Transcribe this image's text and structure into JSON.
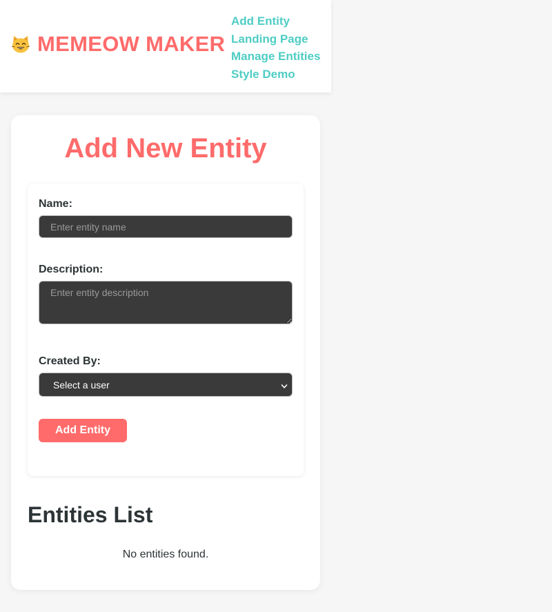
{
  "header": {
    "brand_icon": "smiling-cat-face-icon",
    "brand_title": "MEMEOW MAKER",
    "nav": [
      {
        "label": "Add Entity"
      },
      {
        "label": "Landing Page"
      },
      {
        "label": "Manage Entities"
      },
      {
        "label": "Style Demo"
      }
    ]
  },
  "form": {
    "title": "Add New Entity",
    "name_label": "Name:",
    "name_value": "",
    "name_placeholder": "Enter entity name",
    "description_label": "Description:",
    "description_value": "",
    "description_placeholder": "Enter entity description",
    "created_by_label": "Created By:",
    "created_by_selected": "Select a user",
    "submit_label": "Add Entity"
  },
  "entities": {
    "title": "Entities List",
    "empty_message": "No entities found.",
    "items": []
  },
  "colors": {
    "accent": "#ff6b6b",
    "link": "#4ecdc4",
    "text": "#2d3436",
    "input_bg": "#3a3a3a",
    "page_bg": "#f6f6f6"
  }
}
